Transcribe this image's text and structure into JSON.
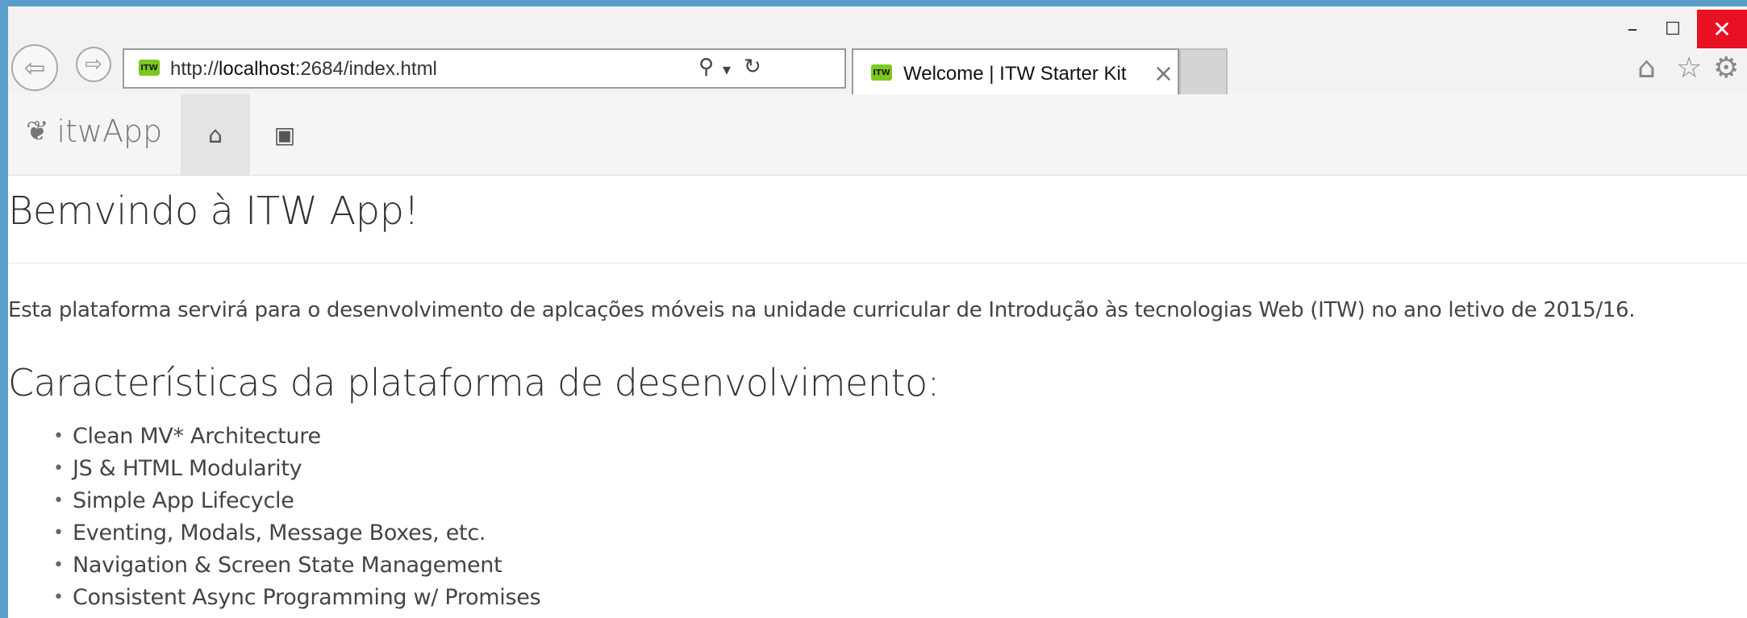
{
  "window": {
    "minimize_label": "–",
    "maximize_label": "☐",
    "close_label": "✕"
  },
  "browser": {
    "url_prefix": "http://",
    "url_host": "localhost",
    "url_rest": ":2684/index.html",
    "favicon_text": "ITW",
    "tab_title": "Welcome | ITW Starter Kit",
    "tab_close": "×",
    "back_glyph": "⇦",
    "forward_glyph": "⇨",
    "search_glyph": "⚲",
    "dropdown_glyph": "▾",
    "refresh_glyph": "↻",
    "home_glyph": "⌂",
    "favorites_glyph": "☆",
    "settings_glyph": "⚙"
  },
  "app": {
    "brand_icon": "❦",
    "brand_name": "itwApp",
    "nav_items": [
      {
        "icon": "home-icon",
        "glyph": "⌂",
        "active": true
      },
      {
        "icon": "gamepad-icon",
        "glyph": "▣",
        "active": false
      }
    ]
  },
  "page": {
    "heading": "Bemvindo à ITW App!",
    "intro": "Esta plataforma servirá para o desenvolvimento de aplcações móveis na unidade curricular de Introdução às tecnologias Web (ITW) no ano letivo de 2015/16.",
    "features_heading": "Características da plataforma de desenvolvimento:",
    "bullet": "•",
    "features": [
      "Clean MV* Architecture",
      "JS & HTML Modularity",
      "Simple App Lifecycle",
      "Eventing, Modals, Message Boxes, etc.",
      "Navigation & Screen State Management",
      "Consistent Async Programming w/ Promises"
    ]
  },
  "colors": {
    "window_border": "#5a9fc9",
    "close_button": "#e81123",
    "favicon": "#7bc820"
  }
}
